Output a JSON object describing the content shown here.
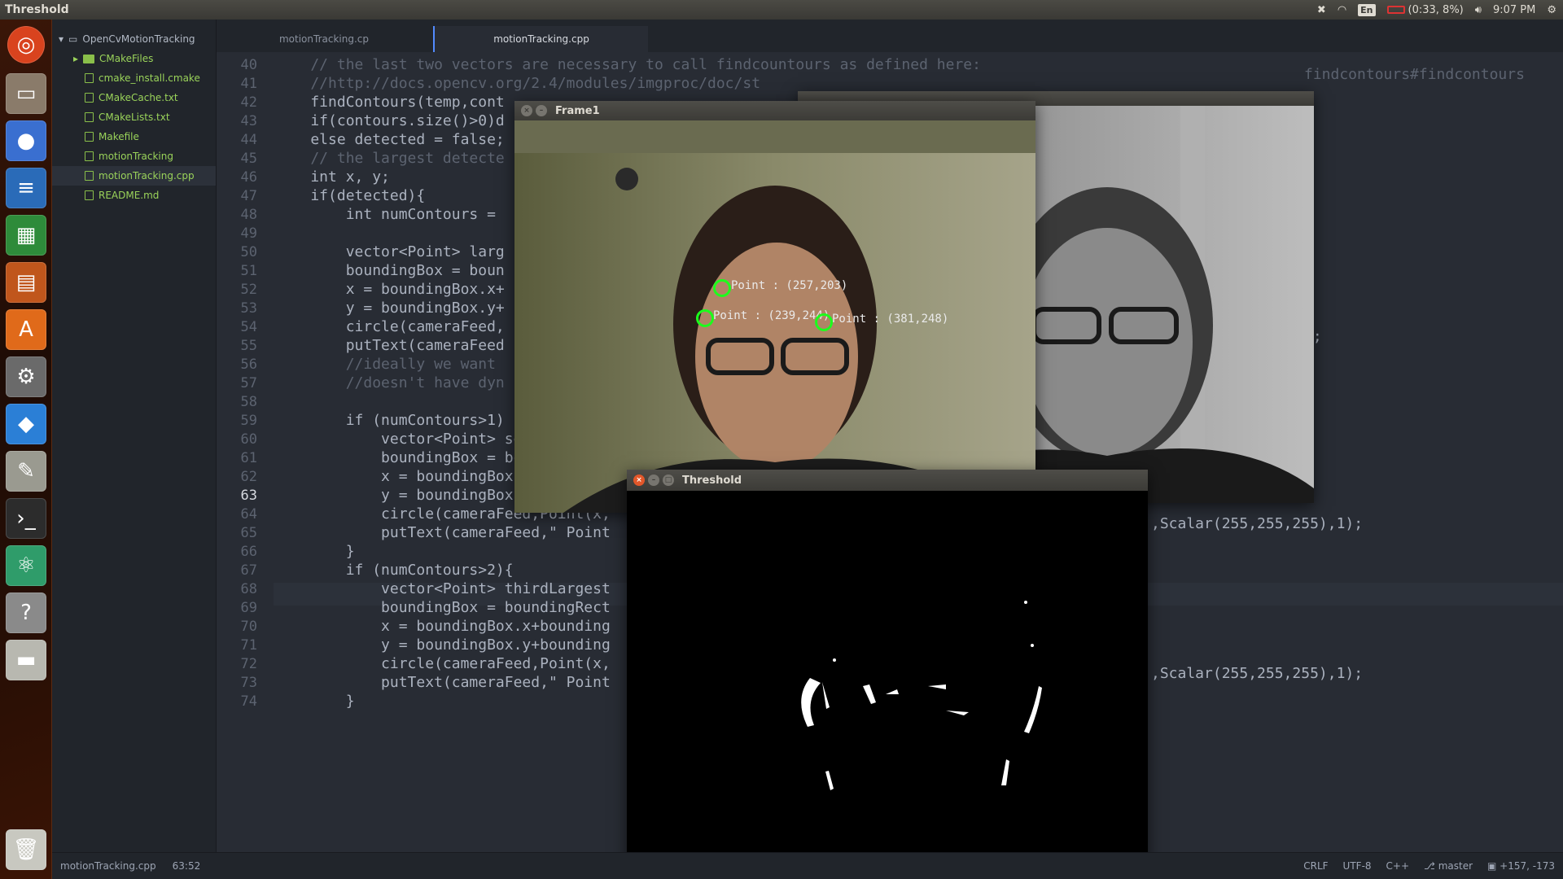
{
  "topbar": {
    "title": "Threshold",
    "keyboard": "En",
    "battery": "(0:33, 8%)",
    "time": "9:07 PM"
  },
  "sidebar": {
    "project": "OpenCvMotionTracking",
    "items": [
      {
        "label": "CMakeFiles",
        "type": "folder"
      },
      {
        "label": "cmake_install.cmake",
        "type": "file"
      },
      {
        "label": "CMakeCache.txt",
        "type": "file"
      },
      {
        "label": "CMakeLists.txt",
        "type": "file"
      },
      {
        "label": "Makefile",
        "type": "file"
      },
      {
        "label": "motionTracking",
        "type": "file"
      },
      {
        "label": "motionTracking.cpp",
        "type": "file",
        "selected": true
      },
      {
        "label": "README.md",
        "type": "file"
      }
    ]
  },
  "tabs": [
    {
      "label": "motionTracking.cp",
      "active": false
    },
    {
      "label": "motionTracking.cpp",
      "active": true
    }
  ],
  "editor": {
    "current_line": "63",
    "lines": [
      {
        "n": "40",
        "text": "    // the last two vectors are necessary to call findcountours as defined here:"
      },
      {
        "n": "41",
        "text": "    //http://docs.opencv.org/2.4/modules/imgproc/doc/st"
      },
      {
        "n": "42",
        "text": "    findContours(temp,cont"
      },
      {
        "n": "43",
        "text": "    if(contours.size()>0)d"
      },
      {
        "n": "44",
        "text": "    else detected = false;"
      },
      {
        "n": "45",
        "text": "    // the largest detecte"
      },
      {
        "n": "46",
        "text": "    int x, y;"
      },
      {
        "n": "47",
        "text": "    if(detected){"
      },
      {
        "n": "48",
        "text": "        int numContours ="
      },
      {
        "n": "49",
        "text": ""
      },
      {
        "n": "50",
        "text": "        vector<Point> larg"
      },
      {
        "n": "51",
        "text": "        boundingBox = boun"
      },
      {
        "n": "52",
        "text": "        x = boundingBox.x+"
      },
      {
        "n": "53",
        "text": "        y = boundingBox.y+"
      },
      {
        "n": "54",
        "text": "        circle(cameraFeed,"
      },
      {
        "n": "55",
        "text": "        putText(cameraFeed"
      },
      {
        "n": "56",
        "text": "        //ideally we want"
      },
      {
        "n": "57",
        "text": "        //doesn't have dyn"
      },
      {
        "n": "58",
        "text": ""
      },
      {
        "n": "59",
        "text": "        if (numContours>1)"
      },
      {
        "n": "60",
        "text": "            vector<Point> secondLarges"
      },
      {
        "n": "61",
        "text": "            boundingBox = boundingRect"
      },
      {
        "n": "62",
        "text": "            x = boundingBox.x+bounding"
      },
      {
        "n": "63",
        "text": "            y = boundingBox.y+bounding"
      },
      {
        "n": "64",
        "text": "            circle(cameraFeed,Point(x,"
      },
      {
        "n": "65",
        "text": "            putText(cameraFeed,\" Point"
      },
      {
        "n": "66",
        "text": "        }"
      },
      {
        "n": "67",
        "text": "        if (numContours>2){"
      },
      {
        "n": "68",
        "text": "            vector<Point> thirdLargest"
      },
      {
        "n": "69",
        "text": "            boundingBox = boundingRect"
      },
      {
        "n": "70",
        "text": "            x = boundingBox.x+bounding"
      },
      {
        "n": "71",
        "text": "            y = boundingBox.y+bounding"
      },
      {
        "n": "72",
        "text": "            circle(cameraFeed,Point(x,"
      },
      {
        "n": "73",
        "text": "            putText(cameraFeed,\" Point"
      },
      {
        "n": "74",
        "text": "        }"
      }
    ],
    "right_fragments": {
      "line41": "findcontours#findcontours",
      "line55": ");",
      "line65": ",Scalar(255,255,255),1);",
      "line73": ",Scalar(255,255,255),1);"
    }
  },
  "windows": {
    "frame1": {
      "title": "Frame1",
      "markers": [
        "Point : (257,203)",
        "Point : (381,248)",
        "Point : (239,244)",
        "Point : (239,244)"
      ]
    },
    "threshold": {
      "title": "Threshold"
    }
  },
  "status": {
    "file": "motionTracking.cpp",
    "cursor": "63:52",
    "line_ending": "CRLF",
    "encoding": "UTF-8",
    "grammar": "C++",
    "branch": "master",
    "diff": "+157, -173"
  },
  "colors": {
    "accent": "#528bff",
    "marker": "#1cff1c",
    "close_button": "#e2572a"
  }
}
